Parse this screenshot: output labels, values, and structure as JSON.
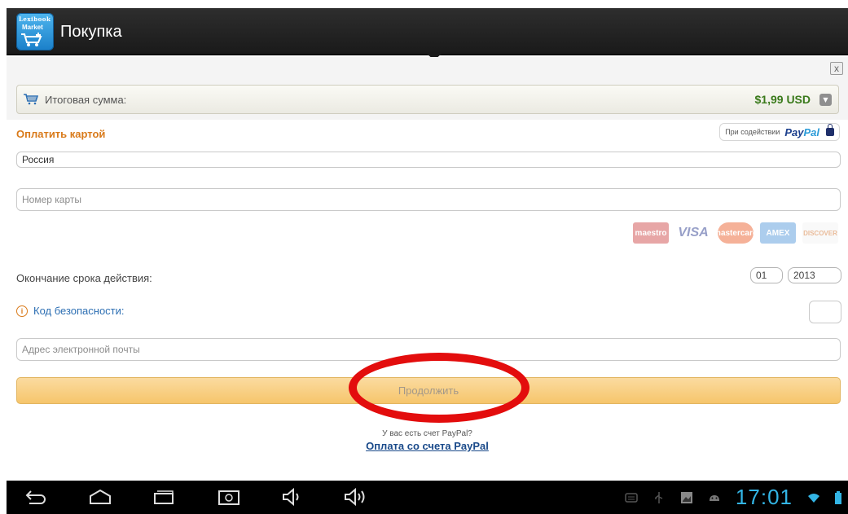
{
  "app": {
    "logo_text": "Lexibook",
    "logo_sub": "Market",
    "title": "Покупка",
    "close_glyph": "x"
  },
  "summary": {
    "label": "Итоговая сумма:",
    "amount": "$1,99 USD"
  },
  "payment": {
    "header": "Оплатить картой",
    "powered_by": "При содействии",
    "paypal_logo_a": "Pay",
    "paypal_logo_b": "Pal",
    "country_value": "Россия",
    "card_number_placeholder": "Номер карты",
    "card_brands": [
      "maestro",
      "VISA",
      "mastercard",
      "AMEX",
      "DISCOVER"
    ],
    "expiry_label": "Окончание срока действия:",
    "expiry_month": "01",
    "expiry_year": "2013",
    "security_label": "Код безопасности:",
    "email_placeholder": "Адрес электронной почты",
    "continue_label": "Продолжить",
    "paypal_question": "У вас есть счет PayPal?",
    "paypal_link": "Оплата со счета PayPal"
  },
  "system_bar": {
    "time": "17:01",
    "nav_icons": [
      "back-icon",
      "home-icon",
      "recent-apps-icon",
      "screenshot-icon",
      "volume-down-icon",
      "volume-up-icon"
    ],
    "status_icons": [
      "keyboard-icon",
      "usb-icon",
      "gallery-icon",
      "android-debug-icon",
      "wifi-icon",
      "battery-icon"
    ]
  },
  "colors": {
    "highlight_oval": "#e30d0d",
    "price_green": "#3a7a1b",
    "header_orange": "#d97a1a",
    "clock_blue": "#33b5e5"
  }
}
